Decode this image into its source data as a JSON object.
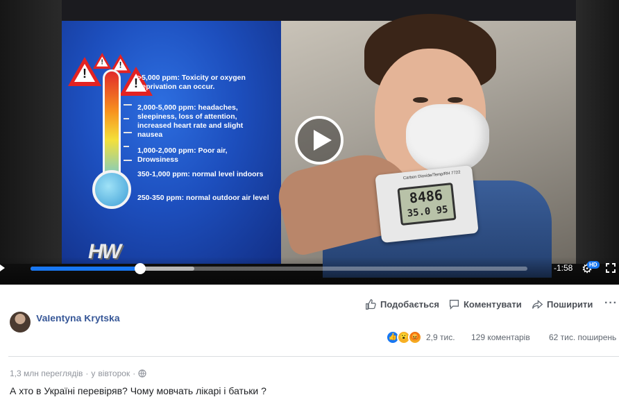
{
  "video": {
    "slide_items": [
      ">5,000 ppm:  Toxicity or oxygen deprivation can occur.",
      "2,000-5,000 ppm: headaches, sleepiness, loss of attention, increased heart rate and slight nausea",
      "1,000-2,000 ppm: Poor air, Drowsiness",
      "350-1,000 ppm: normal level indoors",
      "250-350 ppm: normal outdoor air level"
    ],
    "logo_text": "HW",
    "device_brand": "Carbon Dioxide/Temp/RH 7722",
    "device_reading": "8486",
    "device_reading_small": "35.0 95",
    "time_remaining": "-1:58",
    "hd_label": "HD",
    "progress": 0.22,
    "buffered": 0.33,
    "accent": "#1877f2"
  },
  "actions": {
    "like": "Подобається",
    "comment": "Коментувати",
    "share": "Поширити"
  },
  "post": {
    "author": "Valentyna Krytska",
    "reactions_count": "2,9 тис.",
    "comments_count": "129 коментарів",
    "shares_count": "62 тис. поширень",
    "views": "1,3 млн переглядів",
    "separator": "·",
    "posted_prefix": "у",
    "posted_day": "вівторок",
    "caption": "А хто в Україні перевіряв? Чому мовчать лікарі і батьки ?"
  }
}
